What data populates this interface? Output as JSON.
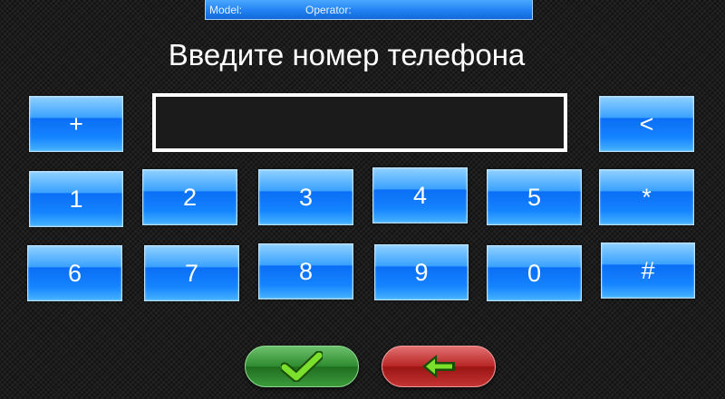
{
  "status_bar": {
    "model_label": "Model:",
    "operator_label": "Operator:"
  },
  "title": "Введите номер телефона",
  "phone_input": {
    "value": ""
  },
  "keys": {
    "plus": "+",
    "backspace": "<",
    "k1": "1",
    "k2": "2",
    "k3": "3",
    "k4": "4",
    "k5": "5",
    "star": "*",
    "k6": "6",
    "k7": "7",
    "k8": "8",
    "k9": "9",
    "k0": "0",
    "hash": "#"
  },
  "icons": {
    "confirm": "checkmark-icon",
    "back": "arrow-left-icon"
  },
  "colors": {
    "key_blue": "#1584ff",
    "confirm_green": "#2e8b2e",
    "back_red": "#b82424",
    "status_bar": "#1f7ef0"
  }
}
